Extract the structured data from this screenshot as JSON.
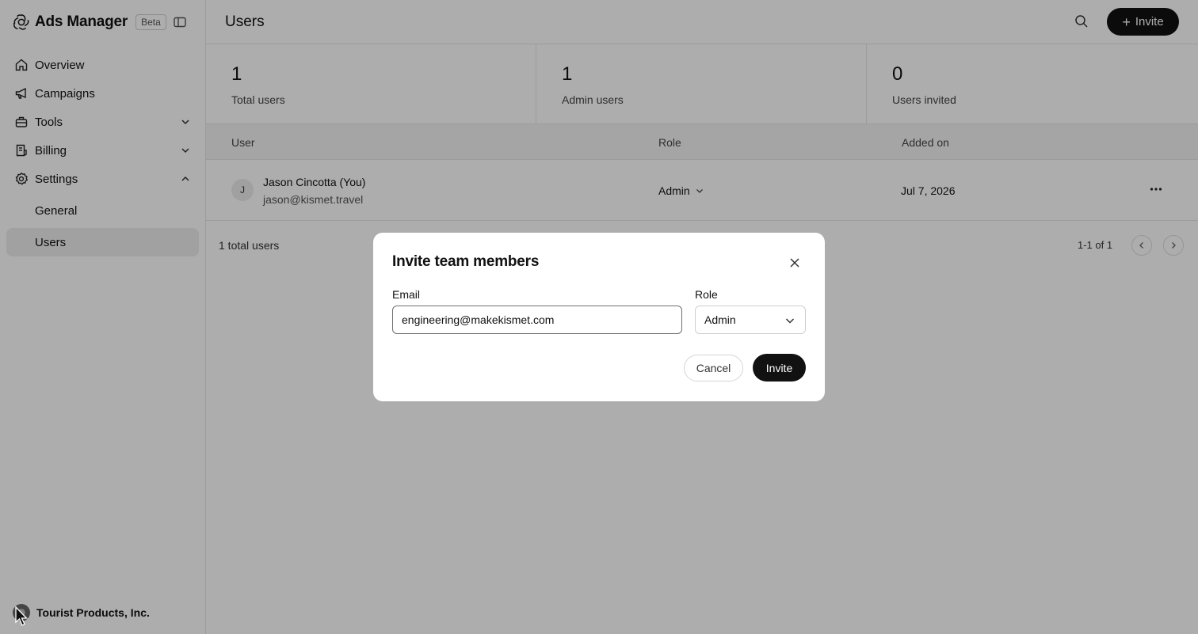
{
  "sidebar": {
    "brand_title": "Ads Manager",
    "beta_badge": "Beta",
    "items": [
      {
        "label": "Overview",
        "icon": "home-icon"
      },
      {
        "label": "Campaigns",
        "icon": "megaphone-icon"
      },
      {
        "label": "Tools",
        "icon": "toolbox-icon"
      },
      {
        "label": "Billing",
        "icon": "receipt-icon"
      },
      {
        "label": "Settings",
        "icon": "gear-icon"
      }
    ],
    "subitems": [
      {
        "label": "General"
      },
      {
        "label": "Users",
        "active": true
      }
    ],
    "org_name": "Tourist Products, Inc."
  },
  "header": {
    "title": "Users",
    "invite_label": "Invite"
  },
  "stats": [
    {
      "value": "1",
      "label": "Total users"
    },
    {
      "value": "1",
      "label": "Admin users"
    },
    {
      "value": "0",
      "label": "Users invited"
    }
  ],
  "table": {
    "columns": [
      "User",
      "Role",
      "Added on"
    ],
    "rows": [
      {
        "initial": "J",
        "name": "Jason Cincotta (You)",
        "email": "jason@kismet.travel",
        "role": "Admin",
        "added_on": "Jul 7, 2026"
      }
    ],
    "footer_count": "1 total users",
    "pagination": "1-1 of 1"
  },
  "modal": {
    "title": "Invite team members",
    "email_label": "Email",
    "email_value": "engineering@makekismet.com",
    "role_label": "Role",
    "role_value": "Admin",
    "cancel_label": "Cancel",
    "invite_label": "Invite"
  },
  "colors": {
    "primary": "#111111",
    "overlay": "rgba(0,0,0,0.32)",
    "active_nav": "#ededed"
  }
}
